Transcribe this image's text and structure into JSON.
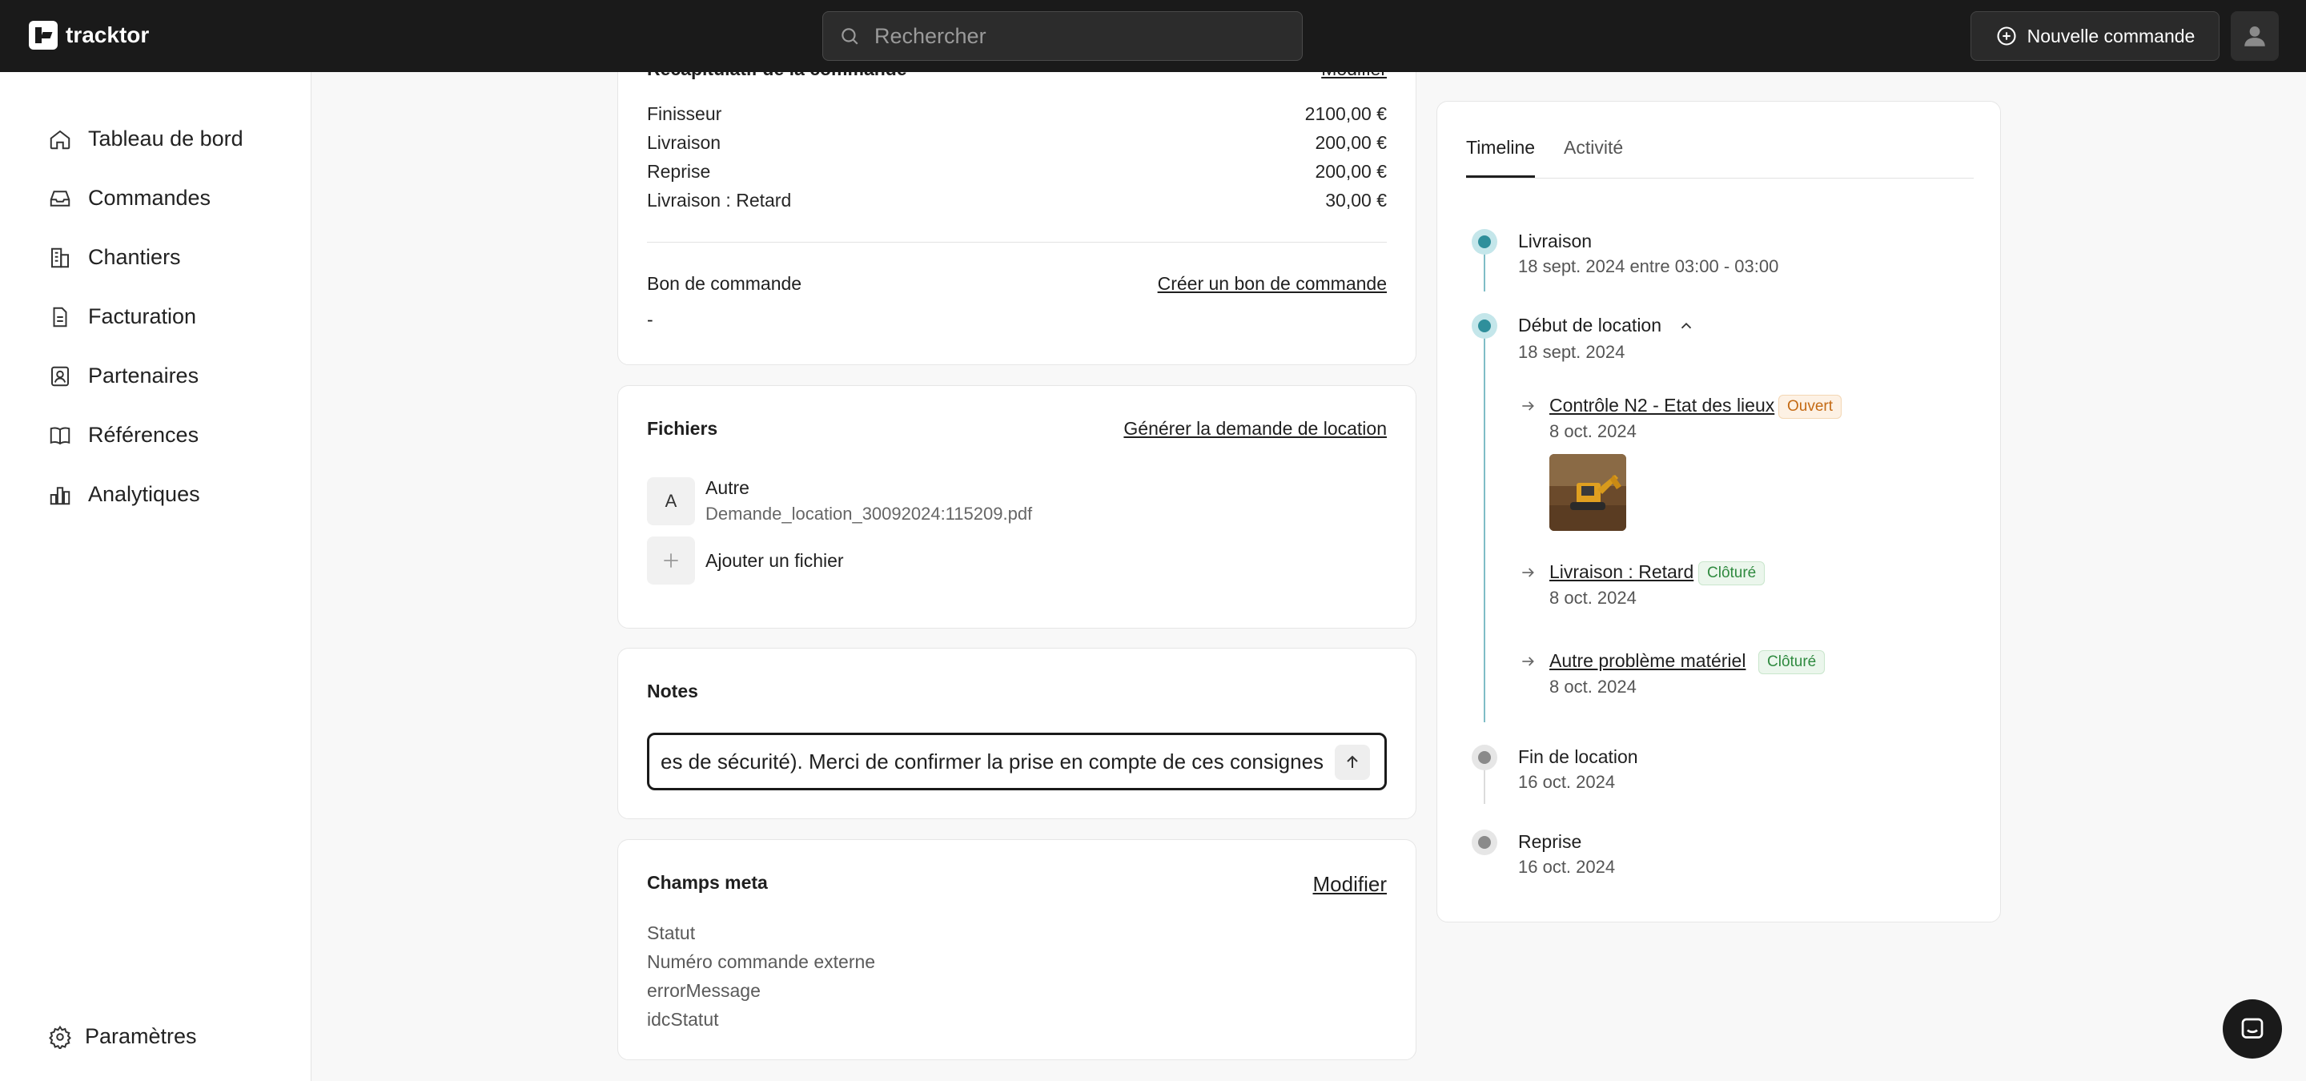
{
  "app": {
    "name": "tracktor"
  },
  "search": {
    "placeholder": "Rechercher"
  },
  "header": {
    "new_order_label": "Nouvelle commande"
  },
  "sidebar": {
    "items": [
      {
        "label": "Tableau de bord",
        "icon": "home-icon"
      },
      {
        "label": "Commandes",
        "icon": "inbox-icon"
      },
      {
        "label": "Chantiers",
        "icon": "buildings-icon"
      },
      {
        "label": "Facturation",
        "icon": "document-icon"
      },
      {
        "label": "Partenaires",
        "icon": "contact-icon"
      },
      {
        "label": "Références",
        "icon": "book-icon"
      },
      {
        "label": "Analytiques",
        "icon": "bar-chart-icon"
      }
    ],
    "settings_label": "Paramètres"
  },
  "summary": {
    "title": "Récapitulatif de la commande",
    "edit_label": "Modifier",
    "lines": [
      {
        "label": "Finisseur",
        "amount": "2100,00 €"
      },
      {
        "label": "Livraison",
        "amount": "200,00 €"
      },
      {
        "label": "Reprise",
        "amount": "200,00 €"
      },
      {
        "label": "Livraison : Retard",
        "amount": "30,00 €"
      }
    ],
    "purchase_order_title": "Bon de commande",
    "purchase_order_link": "Créer un bon de commande",
    "purchase_order_value": "-"
  },
  "files": {
    "title": "Fichiers",
    "generate_link": "Générer la demande de location",
    "items": [
      {
        "initial": "A",
        "type": "Autre",
        "name": "Demande_location_30092024:115209.pdf"
      }
    ],
    "add_label": "Ajouter un fichier"
  },
  "notes": {
    "title": "Notes",
    "value": "es de sécurité). Merci de confirmer la prise en compte de ces consignes"
  },
  "meta": {
    "title": "Champs meta",
    "edit_label": "Modifier",
    "fields": [
      "Statut",
      "Numéro commande externe",
      "errorMessage",
      "idcStatut"
    ]
  },
  "timeline": {
    "tabs": [
      "Timeline",
      "Activité"
    ],
    "active_tab": "Timeline",
    "events": [
      {
        "title": "Livraison",
        "date": "18 sept. 2024 entre 03:00 - 03:00",
        "state": "done"
      },
      {
        "title": "Début de location",
        "date": "18 sept. 2024",
        "state": "done",
        "expanded": true,
        "sub_items": [
          {
            "title": "Contrôle N2 - Etat des lieux",
            "badge": "Ouvert",
            "date": "8 oct. 2024",
            "has_photo": true
          },
          {
            "title": "Livraison : Retard",
            "badge": "Clôturé",
            "date": "8 oct. 2024"
          },
          {
            "title": "Autre problème matériel",
            "badge": "Clôturé",
            "date": "8 oct. 2024"
          }
        ]
      },
      {
        "title": "Fin de location",
        "date": "16 oct. 2024",
        "state": "pending"
      },
      {
        "title": "Reprise",
        "date": "16 oct. 2024",
        "state": "pending"
      }
    ]
  },
  "colors": {
    "topbar": "#1a1a1a",
    "accent_teal": "#2f8f9b",
    "badge_open": "#c46a14",
    "badge_closed": "#2f8a3f"
  }
}
